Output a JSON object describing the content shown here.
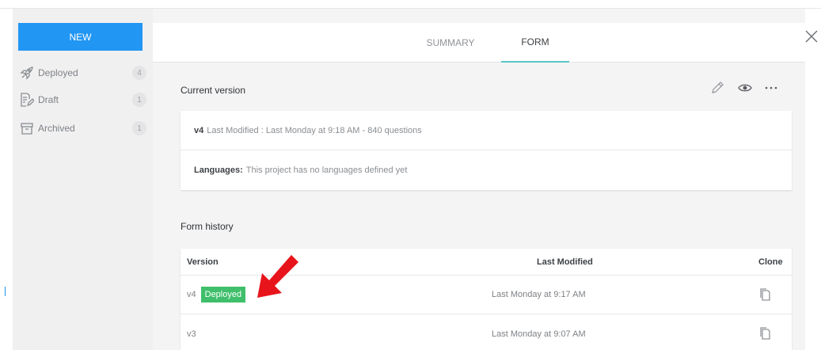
{
  "sidebar": {
    "new_label": "NEW",
    "items": [
      {
        "label": "Deployed",
        "count": "4",
        "icon": "rocket-icon"
      },
      {
        "label": "Draft",
        "count": "1",
        "icon": "draft-icon"
      },
      {
        "label": "Archived",
        "count": "1",
        "icon": "archive-icon"
      }
    ]
  },
  "tabs": [
    {
      "label": "SUMMARY",
      "active": false
    },
    {
      "label": "FORM",
      "active": true
    }
  ],
  "current_version": {
    "title": "Current version",
    "version": "v4",
    "meta": "Last Modified : Last Monday at 9:18 AM - 840 questions",
    "languages_label": "Languages:",
    "languages_value": "This project has no languages defined yet"
  },
  "form_history": {
    "title": "Form history",
    "columns": {
      "version": "Version",
      "modified": "Last Modified",
      "clone": "Clone"
    },
    "rows": [
      {
        "version": "v4",
        "badge": "Deployed",
        "modified": "Last Monday at 9:17 AM"
      },
      {
        "version": "v3",
        "badge": "",
        "modified": "Last Monday at 9:07 AM"
      }
    ]
  },
  "colors": {
    "primary": "#2196f3",
    "tab_underline": "#57c6c6",
    "deployed": "#3fbf6b",
    "arrow": "#e8141b"
  }
}
